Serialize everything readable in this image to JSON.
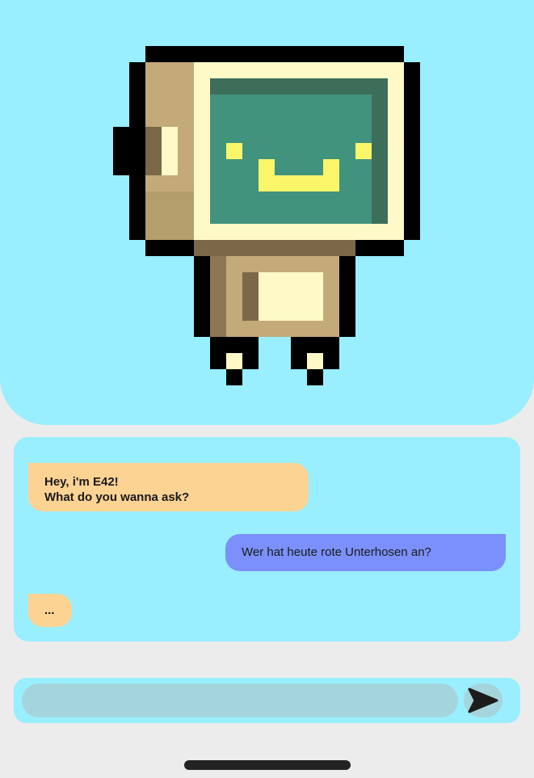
{
  "hero": {
    "mascot_icon": "pixel-robot-icon"
  },
  "chat": {
    "messages": [
      {
        "sender": "bot",
        "text": "Hey, i'm E42!\nWhat do you wanna ask?"
      },
      {
        "sender": "user",
        "text": "Wer hat heute rote Unterhosen an?"
      },
      {
        "sender": "bot",
        "text": "..."
      }
    ]
  },
  "composer": {
    "input_value": "",
    "input_placeholder": "",
    "send_icon": "send-arrow-icon"
  },
  "colors": {
    "background": "#ececec",
    "panel": "#99eeff",
    "bot_bubble": "#fdd394",
    "user_bubble": "#7b90fb",
    "input_fill": "#a5d5dc"
  }
}
